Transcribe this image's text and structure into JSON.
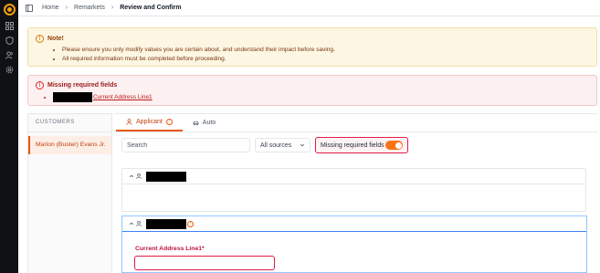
{
  "breadcrumb": [
    "Home",
    "Remarkets",
    "Review and Confirm"
  ],
  "note": {
    "title": "Note!",
    "items": [
      "Please ensure you only modify values you are certain about, and understand their impact before saving.",
      "All required information must be completed before proceeding."
    ]
  },
  "error": {
    "title": "Missing required fields",
    "item_link": "Current Address Line1"
  },
  "customers": {
    "header": "CUSTOMERS",
    "items": [
      "Marion (Buster) Evans Jr."
    ]
  },
  "tabs": [
    {
      "label": "Applicant",
      "icon": "person-icon",
      "active": true
    },
    {
      "label": "Auto",
      "icon": "car-icon",
      "active": false
    }
  ],
  "filters": {
    "search_placeholder": "Search",
    "source_value": "All sources",
    "toggle_label": "Missing required fields",
    "toggle_on": true
  },
  "applicant_panel": {
    "field_label": "Current Address Line1*",
    "field_value": ""
  },
  "colors": {
    "accent": "#ea580c",
    "error": "#e11d48",
    "warning_bg": "#fdf6e3",
    "sidebar_bg": "#0f1115"
  }
}
